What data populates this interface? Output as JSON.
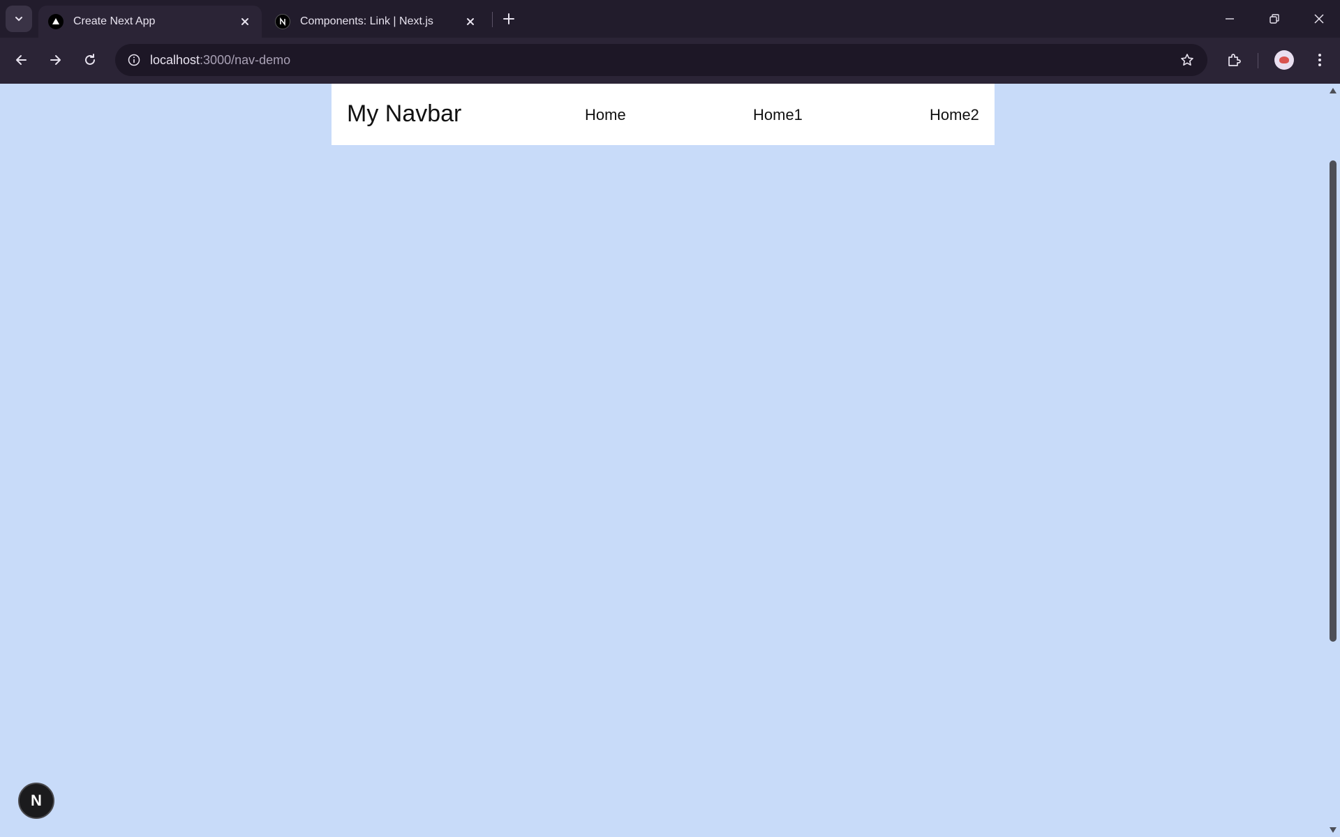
{
  "browser": {
    "tabs": [
      {
        "title": "Create Next App",
        "active": true,
        "favicon": "triangle-icon"
      },
      {
        "title": "Components: Link | Next.js",
        "active": false,
        "favicon": "nextjs-icon"
      }
    ],
    "address": {
      "host": "localhost",
      "path": ":3000/nav-demo"
    }
  },
  "page": {
    "background": "#c8dbf9",
    "navbar": {
      "brand": "My Navbar",
      "links": [
        "Home",
        "Home1",
        "Home2"
      ]
    },
    "dev_indicator": "N"
  }
}
